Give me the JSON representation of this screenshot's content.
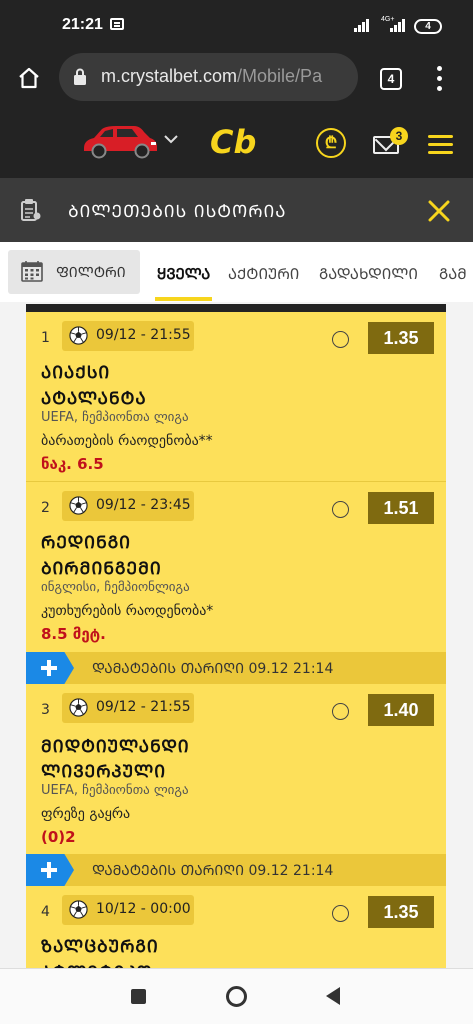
{
  "status_bar": {
    "time": "21:21",
    "lte_label": "4G+",
    "battery": "4"
  },
  "browser": {
    "url_host": "m.crystalbet.com",
    "url_path": "/Mobile/Pa",
    "tab_count": "4"
  },
  "header": {
    "logo_text": "Cb",
    "coin_symbol": "₾",
    "mail_badge": "3"
  },
  "page": {
    "title": "ᲑᲘᲚᲔᲗᲔᲑᲘᲡ ᲘᲡᲢᲝᲠᲘᲐ"
  },
  "filter": {
    "label": "ᲤᲘᲚᲢᲠᲘ"
  },
  "tabs": [
    {
      "label": "ᲧᲕᲔᲚᲐ"
    },
    {
      "label": "ᲐᲥᲢᲘᲣᲠᲘ"
    },
    {
      "label": "ᲒᲐᲓᲐᲮᲓᲘᲚᲘ"
    },
    {
      "label": "ᲒᲐᲛ"
    }
  ],
  "bets": [
    {
      "num": "1",
      "date": "09/12 - 21:55",
      "odds": "1.35",
      "team1": "ᲐᲘᲐᲥᲡᲘ",
      "team2": "ᲐᲢᲐᲚᲐᲜᲢᲐ",
      "league": "UEFA, ჩემპიონთა ლიგა",
      "market": "ბარათების რაოდენობა**",
      "pick": "ნაკ. 6.5"
    },
    {
      "num": "2",
      "date": "09/12 - 23:45",
      "odds": "1.51",
      "team1": "ᲠᲔᲓᲘᲜᲒᲘ",
      "team2": "ᲑᲘᲠᲛᲘᲜᲒᲔᲛᲘ",
      "league": "ინგლისი, ჩემპიონლიგა",
      "market": "კუთხურების რაოდენობა*",
      "pick": "8.5 მეტ."
    },
    {
      "num": "3",
      "date": "09/12 - 21:55",
      "odds": "1.40",
      "team1": "ᲛᲘᲓᲢᲘᲣᲚᲐᲜᲓᲘ",
      "team2": "ᲚᲘᲕᲔᲠᲞᲣᲚᲘ",
      "league": "UEFA, ჩემპიონთა ლიგა",
      "market": "ფრეზე გაყრა",
      "pick": "(0)2"
    },
    {
      "num": "4",
      "date": "10/12 - 00:00",
      "odds": "1.35",
      "team1": "ᲖᲐᲚᲪᲑᲣᲠᲒᲘ",
      "team2": "ᲐᲢᲚᲔᲢᲘᲙᲝ",
      "league": "",
      "market": "",
      "pick": ""
    }
  ],
  "added_rows": [
    {
      "text": "ᲓᲐᲛᲐᲢᲔᲑᲘᲡ ᲗᲐᲠᲘᲦᲘ 09.12 21:14"
    },
    {
      "text": "ᲓᲐᲛᲐᲢᲔᲑᲘᲡ ᲗᲐᲠᲘᲦᲘ 09.12 21:14"
    }
  ],
  "colors": {
    "accent": "#f7d51d",
    "card": "#fde05a",
    "odds_bg": "#7f6a10",
    "pick": "#c0111b",
    "plus": "#1b89e6"
  }
}
